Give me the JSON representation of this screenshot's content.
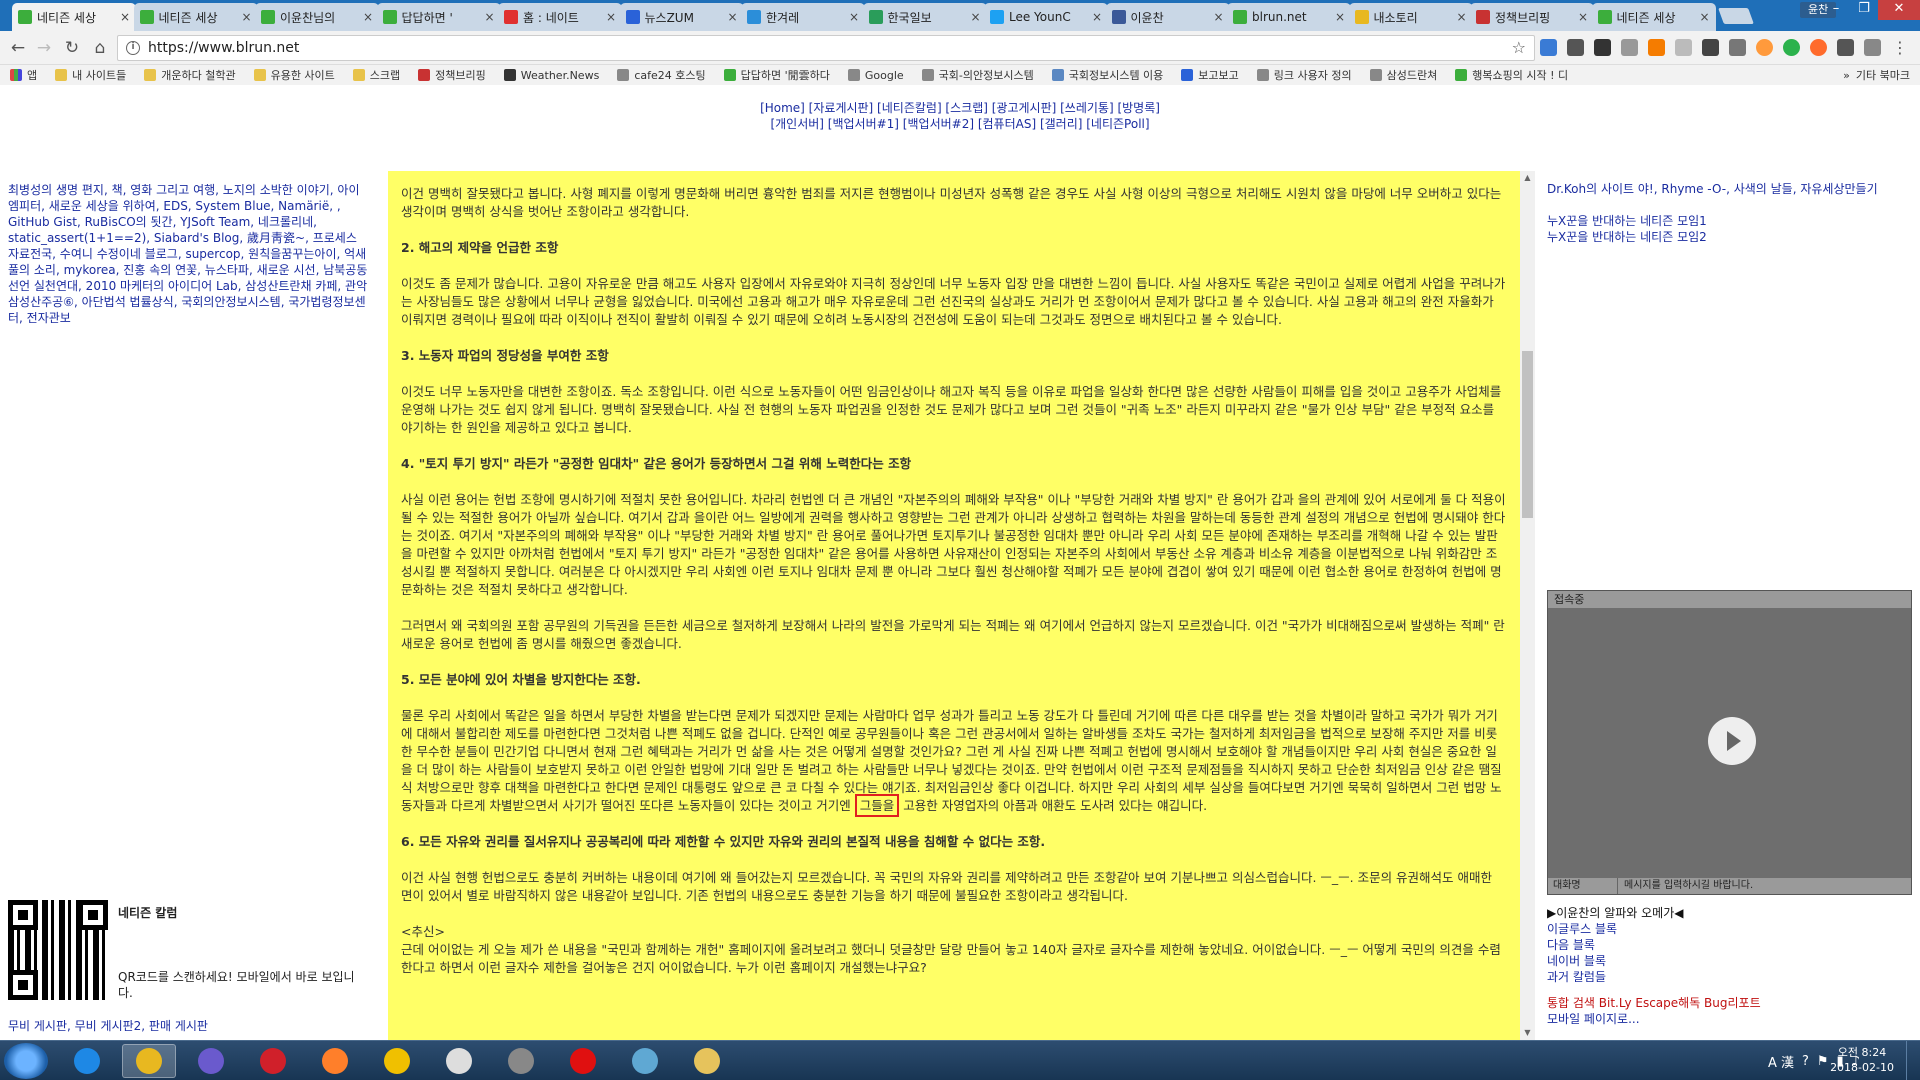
{
  "tabs": [
    {
      "title": "네티즌 세상",
      "favicon_color": "#3cae3c",
      "active": true
    },
    {
      "title": "네티즌 세상",
      "favicon_color": "#3cae3c",
      "active": false
    },
    {
      "title": "이윤찬님의",
      "favicon_color": "#3cae3c",
      "active": false
    },
    {
      "title": "답답하면 '",
      "favicon_color": "#3cae3c",
      "active": false
    },
    {
      "title": "홈 : 네이트",
      "favicon_color": "#e03030",
      "active": false
    },
    {
      "title": "뉴스ZUM",
      "favicon_color": "#2a62d8",
      "active": false
    },
    {
      "title": "한겨레",
      "favicon_color": "#2b8ed9",
      "active": false
    },
    {
      "title": "한국일보",
      "favicon_color": "#2a9d5a",
      "active": false
    },
    {
      "title": "Lee YounC",
      "favicon_color": "#1da1f2",
      "active": false
    },
    {
      "title": "이윤찬",
      "favicon_color": "#3b5998",
      "active": false
    },
    {
      "title": "blrun.net",
      "favicon_color": "#3cae3c",
      "active": false
    },
    {
      "title": "내소토리",
      "favicon_color": "#e8b820",
      "active": false
    },
    {
      "title": "정책브리핑",
      "favicon_color": "#c83232",
      "active": false
    },
    {
      "title": "네티즌 세상",
      "favicon_color": "#3cae3c",
      "active": false
    }
  ],
  "window": {
    "profile": "윤찬"
  },
  "address": {
    "url": "https://www.blrun.net",
    "info_glyph": "i",
    "star_glyph": "☆",
    "menu_glyph": "⋮"
  },
  "nav_glyphs": {
    "back": "←",
    "forward": "→",
    "reload": "↻",
    "home": "⌂"
  },
  "bookmarks": [
    {
      "label": "앱",
      "color": "#4a90d9"
    },
    {
      "label": "내 사이트들",
      "color": "#e8c34a"
    },
    {
      "label": "개운하다 철학관",
      "color": "#e8c34a"
    },
    {
      "label": "유용한 사이트",
      "color": "#e8c34a"
    },
    {
      "label": "스크랩",
      "color": "#e8c34a"
    },
    {
      "label": "정책브리핑",
      "color": "#c83232"
    },
    {
      "label": "Weather.News",
      "color": "#333333"
    },
    {
      "label": "cafe24 호스팅",
      "color": "#888888"
    },
    {
      "label": "답답하면 '閒雲하다",
      "color": "#3cae3c"
    },
    {
      "label": "Google",
      "color": "#888888"
    },
    {
      "label": "국회-의안정보시스템",
      "color": "#888888"
    },
    {
      "label": "국회정보시스템 이용",
      "color": "#5b88c2"
    },
    {
      "label": "보고보고",
      "color": "#2a62d8"
    },
    {
      "label": "링크 사용자 정의",
      "color": "#888888"
    },
    {
      "label": "삼성드란쳐",
      "color": "#888888"
    },
    {
      "label": "행복쇼핑의 시작 ! 디",
      "color": "#3cae3c"
    }
  ],
  "bookmarks_more": {
    "chevron": "»",
    "other": "기타 북마크"
  },
  "topnav": {
    "line1": "[Home] [자료게시판] [네티즌칼럼] [스크랩] [광고게시판] [쓰레기통] [방명록]",
    "line2": "[개인서버] [백업서버#1] [백업서버#2] [컴퓨터AS] [갤러리] [네티즌Poll]"
  },
  "left_links": "최병성의 생명 편지, 책, 영화 그리고 여행, 노지의 소박한 이야기, 아이엠피터, 새로운 세상을 위하여, EDS, System Blue, Namärië, , GitHub Gist, RuBisCO의 됫간, YJSoft Team, 네크롤리네, static_assert(1+1==2), Siabard's Blog, 歲月靑瓷~, 프로세스 자료전국, 수여니 수정이네 블로그, supercop, 원칙을꿈꾸는아이, 억새풀의 소리, mykorea, 진홍 속의 연꽃, 뉴스타파, 새로운 시선, 남북공동선언 실천연대, 2010 마케터의 아이디어 Lab, 삼성산트란채 카페, 관악삼성산주공⑥, 아단법석 법률상식, 국회의안정보시스템, 국가법령정보센터, 전자관보",
  "qr": {
    "title": "네티즌 칼럼",
    "desc": "QR코드를 스캔하세요! 모바일에서 바로 보입니다."
  },
  "left_bottom_links": "무비 게시판, 무비 게시판2, 판매 게시판",
  "article": {
    "p0": "이건 명백히 잘못됐다고 봅니다. 사형 폐지를 이렇게 명문화해 버리면 흉악한 범죄를 저지른 현행범이나 미성년자 성폭행 같은 경우도 사실 사형 이상의 극형으로 처리해도 시원치 않을 마당에 너무 오버하고 있다는 생각이며 명백히 상식을 벗어난 조항이라고 생각합니다.",
    "h2": "2. 해고의 제약을 언급한 조항",
    "p2": "이것도 좀 문제가 많습니다. 고용이 자유로운 만큼 해고도 사용자 입장에서 자유로와야 지극히 정상인데 너무 노동자 입장 만을 대변한 느낌이 듭니다. 사실 사용자도 똑같은 국민이고 실제로 어렵게 사업을 꾸려나가는 사장님들도 많은 상황에서 너무나 균형을 잃었습니다. 미국에선 고용과 해고가 매우 자유로운데 그런 선진국의 실상과도 거리가 먼 조항이어서 문제가 많다고 볼 수 있습니다. 사실 고용과 해고의 완전 자율화가 이뤄지면 경력이나 필요에 따라 이직이나 전직이 활발히 이뤄질 수 있기 때문에 오히려 노동시장의 건전성에 도움이 되는데 그것과도 정면으로 배치된다고 볼 수 있습니다.",
    "h3": "3. 노동자 파업의 정당성을 부여한 조항",
    "p3": "이것도 너무 노동자만을 대변한 조항이죠. 독소 조항입니다. 이런 식으로 노동자들이 어떤 임금인상이나 해고자 복직 등을 이유로 파업을 일상화 한다면 많은 선량한 사람들이 피해를 입을 것이고 고용주가 사업체를 운영해 나가는 것도 쉽지 않게 됩니다. 명백히 잘못됐습니다. 사실 전 현행의 노동자 파업권을 인정한 것도 문제가 많다고 보며 그런 것들이 \"귀족 노조\" 라든지 미꾸라지 같은 \"물가 인상 부담\" 같은 부정적 요소를 야기하는 한 원인을 제공하고 있다고 봅니다.",
    "h4": "4. \"토지 투기 방지\" 라든가 \"공정한 임대차\" 같은 용어가 등장하면서 그걸 위해 노력한다는 조항",
    "p4": "사실 이런 용어는 헌법 조항에 명시하기에 적절치 못한 용어입니다. 차라리 헌법엔 더 큰 개념인 \"자본주의의 폐해와 부작용\" 이나 \"부당한 거래와 차별 방지\" 란 용어가 갑과 을의 관계에 있어 서로에게 둘 다 적용이 될 수 있는 적절한 용어가 아닐까 싶습니다. 여기서 갑과 을이란 어느 일방에게 권력을 행사하고 영향받는 그런 관계가 아니라 상생하고 협력하는 차원을 말하는데 동등한 관계 설정의 개념으로 헌법에 명시돼야 한다는 것이죠. 여기서 \"자본주의의 폐해와 부작용\" 이나 \"부당한 거래와 차별 방지\" 란 용어로 풀어나가면 토지투기나 불공정한 임대차 뿐만 아니라 우리 사회 모든 분야에 존재하는 부조리를 개혁해 나갈 수 있는 발판을 마련할 수 있지만 아까처럼 헌법에서 \"토지 투기 방지\" 라든가 \"공정한 임대차\" 같은 용어를 사용하면 사유재산이 인정되는 자본주의 사회에서 부동산 소유 계층과 비소유 계층을 이분법적으로 나눠 위화감만 조성시킬 뿐 적절하지 못합니다. 여러분은 다 아시겠지만 우리 사회엔 이런 토지나 임대차 문제 뿐 아니라 그보다 훨씬 청산해야할 적폐가 모든 분야에 겹겹이 쌓여 있기 때문에 이런 협소한 용어로 한정하여 헌법에 명문화하는 것은 적절치 못하다고 생각합니다.",
    "p4b": "그러면서 왜 국회의원 포함 공무원의 기득권을 든든한 세금으로 철저하게 보장해서 나라의 발전을 가로막게 되는 적폐는 왜 여기에서 언급하지 않는지 모르겠습니다. 이건 \"국가가 비대해짐으로써 발생하는 적폐\" 란 새로운 용어로 헌법에 좀 명시를 해줬으면 좋겠습니다.",
    "h5": "5. 모든 분야에 있어 차별을 방지한다는 조항.",
    "p5_before": "물론 우리 사회에서 똑같은 일을 하면서 부당한 차별을 받는다면 문제가 되겠지만 문제는 사람마다 업무 성과가 틀리고 노동 강도가 다 틀린데 거기에 따른 다른 대우를 받는 것을 차별이라 말하고 국가가 뭐가 거기에 대해서 불합리한 제도를 마련한다면 그것처럼 나쁜 적폐도 없을 겁니다. 단적인 예로 공무원들이나 혹은 그런 관공서에서 일하는 알바생들 조차도 국가는 철저하게 최저임금을 법적으로 보장해 주지만 저를 비롯한 무수한 분들이 민간기업 다니면서 현재 그런 혜택과는 거리가 먼 삶을 사는 것은 어떻게 설명할 것인가요? 그런 게 사실 진짜 나쁜 적폐고 헌법에 명시해서 보호해야 할 개념들이지만 우리 사회 현실은 중요한 일을 더 많이 하는 사람들이 보호받지 못하고 이런 안일한 법망에 기대 일만 돈 벌려고 하는 사람들만 너무나 넣겠다는 것이죠. 만약 헌법에서 이런 구조적 문제점들을 직시하지 못하고 단순한 최저임금 인상 같은 땜질식 처방으로만 향후 대책을 마련한다고 한다면 문제인 대통령도 앞으로 큰 코 다칠 수 있다는 얘기죠. 최저임금인상 좋다 이겁니다. 하지만 우리 사회의 세부 실상을 들여다보면 거기엔 묵묵히 일하면서 그런 법망 노동자들과 다르게 차별받으면서 사기가 떨어진 또다른 노동자들이 있다는 것이고 거기엔 ",
    "p5_highlight": "그들을",
    "p5_after": " 고용한 자영업자의 아픔과 애환도 도사려 있다는 얘깁니다.",
    "h6": "6. 모든 자유와 권리를 질서유지나 공공복리에 따라 제한할 수 있지만 자유와 권리의 본질적 내용을 침해할 수 없다는 조항.",
    "p6": "이건 사실 현행 헌법으로도 충분히 커버하는 내용이데 여기에 왜 들어갔는지 모르겠습니다. 꼭 국민의 자유와 권리를 제약하려고 만든 조항같아 보여 기분나쁘고 의심스럽습니다. ㅡ_ㅡ. 조문의 유권해석도 애매한 면이 있어서 별로 바람직하지 않은 내용같아 보입니다. 기존 헌법의 내용으로도 충분한 기능을 하기 때문에 불필요한 조항이라고 생각됩니다.",
    "ps_label": "<추신>",
    "ps": "근데 어이없는 게 오늘 제가 쓴 내용을 \"국민과 함께하는 개헌\" 홈페이지에 올려보려고 했더니 덧글창만 달랑 만들어 놓고 140자 글자로 글자수를 제한해 놓았네요. 어이없습니다. ㅡ_ㅡ 어떻게 국민의 의견을 수렴한다고 하면서 이런 글자수 제한을 걸어놓은 건지 어이없습니다. 누가 이런 홈페이지 개설했는냐구요?"
  },
  "right": {
    "top_links": "Dr.Koh의 사이트 야!, Rhyme -O-, 사색의 날들, 자유세상만들기",
    "link_a": "누X꾼을 반대하는 네티즌 모임1",
    "link_b": "누X꾼을 반대하는 네티즌 모임2",
    "chat_header": "접속중",
    "chat_nick": "대화명",
    "chat_placeholder": "메시지를 입력하시길 바랍니다.",
    "blog_title": "▶이윤찬의 알파와 오메가◀",
    "blog1": "이글루스 블록",
    "blog2": "다음 블록",
    "blog3": "네이버 블록",
    "blog4": "과거 칼럼들",
    "bottom1": "통합 검색 Bit.Ly Escape해독 Bug리포트",
    "bottom2": "모바일 페이지로..."
  },
  "taskbar": {
    "apps": [
      {
        "name": "ie",
        "color": "#1e88e5",
        "active": false
      },
      {
        "name": "chrome",
        "color": "#e8b820",
        "active": true
      },
      {
        "name": "app-s",
        "color": "#6a5acd",
        "active": false
      },
      {
        "name": "opera",
        "color": "#d0202a",
        "active": false
      },
      {
        "name": "firefox",
        "color": "#ff7f2a",
        "active": false
      },
      {
        "name": "tool",
        "color": "#f0c000",
        "active": false
      },
      {
        "name": "media",
        "color": "#dddddd",
        "active": false
      },
      {
        "name": "book",
        "color": "#888888",
        "active": false
      },
      {
        "name": "record",
        "color": "#e01010",
        "active": false
      },
      {
        "name": "network",
        "color": "#5fa8d3",
        "active": false
      },
      {
        "name": "explorer",
        "color": "#e6c35c",
        "active": false
      }
    ],
    "ime": "A 漢",
    "time": "오전 8:24",
    "date": "2018-02-10"
  }
}
